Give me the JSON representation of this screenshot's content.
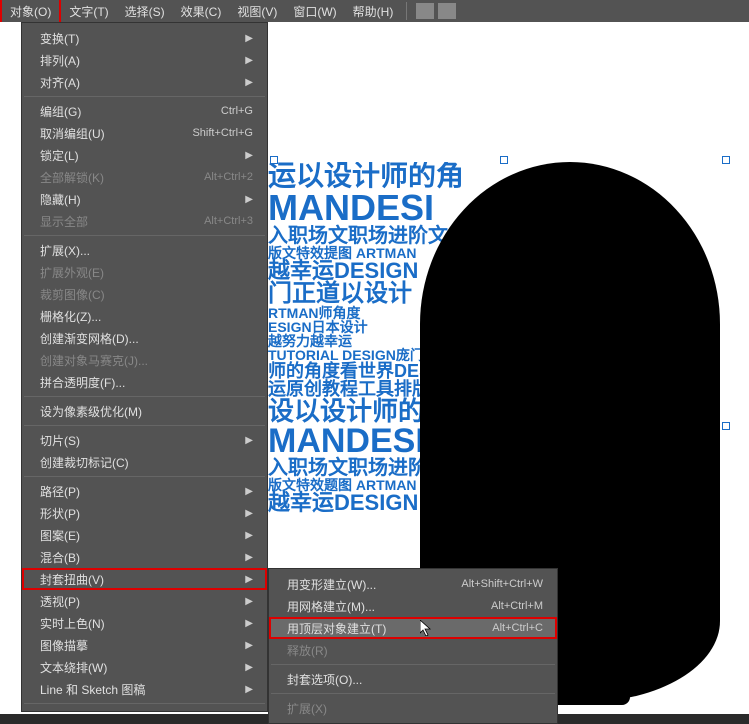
{
  "menubar": {
    "items": [
      {
        "label": "对象(O)",
        "highlighted": true
      },
      {
        "label": "文字(T)"
      },
      {
        "label": "选择(S)"
      },
      {
        "label": "效果(C)"
      },
      {
        "label": "视图(V)"
      },
      {
        "label": "窗口(W)"
      },
      {
        "label": "帮助(H)"
      }
    ]
  },
  "dropdown": [
    {
      "label": "变换(T)",
      "arrow": true
    },
    {
      "label": "排列(A)",
      "arrow": true
    },
    {
      "label": "对齐(A)",
      "arrow": true
    },
    {
      "sep": true
    },
    {
      "label": "编组(G)",
      "shortcut": "Ctrl+G"
    },
    {
      "label": "取消编组(U)",
      "shortcut": "Shift+Ctrl+G"
    },
    {
      "label": "锁定(L)",
      "arrow": true
    },
    {
      "label": "全部解锁(K)",
      "shortcut": "Alt+Ctrl+2",
      "disabled": true
    },
    {
      "label": "隐藏(H)",
      "arrow": true
    },
    {
      "label": "显示全部",
      "shortcut": "Alt+Ctrl+3",
      "disabled": true
    },
    {
      "sep": true
    },
    {
      "label": "扩展(X)..."
    },
    {
      "label": "扩展外观(E)",
      "disabled": true
    },
    {
      "label": "裁剪图像(C)",
      "disabled": true
    },
    {
      "label": "栅格化(Z)..."
    },
    {
      "label": "创建渐变网格(D)..."
    },
    {
      "label": "创建对象马赛克(J)...",
      "disabled": true
    },
    {
      "label": "拼合透明度(F)..."
    },
    {
      "sep": true
    },
    {
      "label": "设为像素级优化(M)"
    },
    {
      "sep": true
    },
    {
      "label": "切片(S)",
      "arrow": true
    },
    {
      "label": "创建裁切标记(C)"
    },
    {
      "sep": true
    },
    {
      "label": "路径(P)",
      "arrow": true
    },
    {
      "label": "形状(P)",
      "arrow": true
    },
    {
      "label": "图案(E)",
      "arrow": true
    },
    {
      "label": "混合(B)",
      "arrow": true
    },
    {
      "label": "封套扭曲(V)",
      "arrow": true,
      "highlighted": true
    },
    {
      "label": "透视(P)",
      "arrow": true
    },
    {
      "label": "实时上色(N)",
      "arrow": true
    },
    {
      "label": "图像描摹",
      "arrow": true
    },
    {
      "label": "文本绕排(W)",
      "arrow": true
    },
    {
      "label": "Line 和 Sketch 图稿",
      "arrow": true
    },
    {
      "sep": true
    }
  ],
  "submenu": [
    {
      "label": "用变形建立(W)...",
      "shortcut": "Alt+Shift+Ctrl+W"
    },
    {
      "label": "用网格建立(M)...",
      "shortcut": "Alt+Ctrl+M"
    },
    {
      "label": "用顶层对象建立(T)",
      "shortcut": "Alt+Ctrl+C",
      "highlighted": true
    },
    {
      "label": "释放(R)",
      "disabled": true
    },
    {
      "sep": true
    },
    {
      "label": "封套选项(O)..."
    },
    {
      "sep": true
    },
    {
      "label": "扩展(X)",
      "disabled": true
    }
  ],
  "canvas_text": [
    {
      "t": "运以设计师的角",
      "s": 28
    },
    {
      "t": "MANDESI",
      "s": 36
    },
    {
      "t": "入职场文职场进阶文",
      "s": 20
    },
    {
      "t": "版文特效提图 ARTMAN",
      "s": 14
    },
    {
      "t": "越幸运DESIGN",
      "s": 22
    },
    {
      "t": "门正道以设计",
      "s": 24
    },
    {
      "t": "RTMAN师角度",
      "s": 14
    },
    {
      "t": "ESIGN日本设计",
      "s": 14
    },
    {
      "t": "越努力越幸运",
      "s": 14
    },
    {
      "t": "TUTORIAL DESIGN庞门正道",
      "s": 14
    },
    {
      "t": "师的角度看世界DESIGN",
      "s": 18
    },
    {
      "t": "运原创教程工具排版文",
      "s": 18
    },
    {
      "t": "设以设计师的角",
      "s": 26
    },
    {
      "t": "MANDESIGI",
      "s": 34
    },
    {
      "t": "入职场文职场进阶文庞",
      "s": 20
    },
    {
      "t": "版文特效题图 ARTMAN WOR",
      "s": 14
    },
    {
      "t": "越幸运DESIGN",
      "s": 22
    }
  ]
}
